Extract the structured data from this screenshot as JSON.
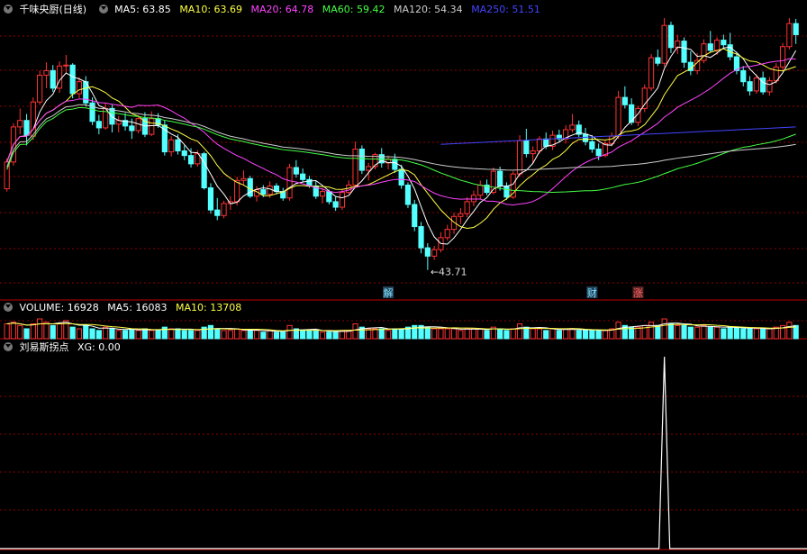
{
  "header": {
    "title": "千味央厨(日线)",
    "ma": [
      {
        "label": "MA5: 63.85",
        "color": "#ffffff"
      },
      {
        "label": "MA10: 63.69",
        "color": "#ffff44"
      },
      {
        "label": "MA20: 64.78",
        "color": "#ff44ff"
      },
      {
        "label": "MA60: 59.42",
        "color": "#44ff44"
      },
      {
        "label": "MA120: 54.34",
        "color": "#cccccc"
      },
      {
        "label": "MA250: 51.51",
        "color": "#4444ff"
      }
    ]
  },
  "volume_header": {
    "label": "VOLUME: 16928",
    "ma5": "MA5: 16083",
    "ma10": "MA10: 13708"
  },
  "indicator_header": {
    "label": "刘易斯拐点",
    "xg": "XG: 0.00"
  },
  "annotations": {
    "low_label": "←43.71",
    "markers": [
      {
        "text": "解",
        "color": "#7fe0ff",
        "bg": "#23435a"
      },
      {
        "text": "财",
        "color": "#7fe0ff",
        "bg": "#23435a"
      },
      {
        "text": "涨",
        "color": "#ff6666",
        "bg": "#5a2323"
      }
    ]
  },
  "colors": {
    "up": "#ff3232",
    "down": "#54ffff",
    "grid": "#8b0000",
    "ma5": "#ffffff",
    "ma10": "#ffff44",
    "ma20": "#ff44ff",
    "ma60": "#44ff44",
    "ma120": "#cccccc",
    "ma250": "#4444ff",
    "xg": "#ffffff"
  },
  "chart_data": {
    "type": "candlestick",
    "price_range": [
      42.5,
      71.0
    ],
    "candles": [
      [
        52.5,
        55.8,
        52.2,
        55.4
      ],
      [
        55.4,
        59.6,
        55.0,
        59.2
      ],
      [
        59.2,
        61.2,
        58.4,
        59.9
      ],
      [
        59.9,
        60.6,
        57.2,
        58.3
      ],
      [
        58.2,
        62.4,
        57.8,
        61.9
      ],
      [
        61.9,
        65.3,
        61.6,
        64.8
      ],
      [
        64.8,
        66.2,
        63.4,
        65.3
      ],
      [
        65.3,
        65.9,
        63.0,
        63.4
      ],
      [
        63.4,
        66.3,
        62.9,
        65.8
      ],
      [
        65.8,
        67.0,
        65.1,
        65.9
      ],
      [
        65.9,
        66.1,
        62.3,
        62.8
      ],
      [
        62.8,
        64.6,
        62.3,
        64.1
      ],
      [
        64.1,
        64.7,
        61.4,
        61.8
      ],
      [
        61.8,
        62.4,
        59.4,
        59.8
      ],
      [
        59.8,
        60.5,
        58.4,
        59.1
      ],
      [
        59.1,
        61.8,
        58.9,
        61.2
      ],
      [
        61.2,
        61.6,
        58.6,
        59.5
      ],
      [
        59.5,
        60.4,
        58.6,
        59.9
      ],
      [
        59.9,
        60.7,
        58.8,
        59.3
      ],
      [
        59.3,
        60.1,
        57.9,
        58.8
      ],
      [
        58.8,
        60.5,
        58.5,
        60.1
      ],
      [
        60.1,
        60.8,
        58.1,
        58.4
      ],
      [
        58.4,
        60.9,
        58.2,
        60.1
      ],
      [
        60.1,
        60.7,
        59.1,
        59.4
      ],
      [
        59.4,
        59.9,
        56.1,
        56.5
      ],
      [
        56.5,
        58.2,
        56.0,
        57.8
      ],
      [
        57.8,
        58.4,
        56.2,
        56.6
      ],
      [
        56.6,
        57.2,
        55.6,
        56.1
      ],
      [
        56.1,
        56.9,
        54.8,
        55.2
      ],
      [
        55.2,
        56.7,
        54.9,
        56.3
      ],
      [
        56.3,
        56.5,
        52.4,
        52.6
      ],
      [
        52.6,
        53.1,
        49.8,
        50.2
      ],
      [
        50.2,
        51.5,
        49.1,
        49.6
      ],
      [
        49.6,
        51.2,
        49.3,
        50.9
      ],
      [
        50.9,
        51.7,
        50.2,
        51.1
      ],
      [
        51.1,
        53.8,
        50.7,
        53.4
      ],
      [
        53.4,
        54.5,
        52.9,
        53.6
      ],
      [
        53.6,
        53.9,
        51.5,
        51.7
      ],
      [
        51.7,
        52.8,
        51.1,
        52.4
      ],
      [
        52.4,
        52.9,
        51.6,
        51.9
      ],
      [
        51.9,
        53.3,
        51.5,
        52.8
      ],
      [
        52.8,
        53.1,
        51.9,
        52.2
      ],
      [
        52.2,
        52.6,
        51.2,
        51.5
      ],
      [
        51.5,
        55.2,
        51.2,
        54.8
      ],
      [
        54.8,
        55.6,
        53.7,
        54.1
      ],
      [
        54.1,
        54.7,
        53.2,
        53.5
      ],
      [
        53.5,
        53.9,
        52.6,
        52.8
      ],
      [
        52.8,
        53.3,
        51.4,
        51.7
      ],
      [
        51.7,
        52.6,
        50.9,
        52.2
      ],
      [
        52.2,
        52.4,
        50.8,
        51.1
      ],
      [
        51.1,
        51.6,
        50.1,
        50.5
      ],
      [
        50.5,
        52.4,
        50.2,
        52.1
      ],
      [
        52.1,
        53.4,
        51.9,
        52.9
      ],
      [
        52.9,
        57.6,
        52.6,
        56.8
      ],
      [
        56.8,
        57.2,
        54.1,
        54.5
      ],
      [
        54.5,
        55.3,
        53.4,
        54.9
      ],
      [
        54.9,
        56.4,
        54.6,
        56.2
      ],
      [
        56.2,
        56.9,
        54.8,
        55.3
      ],
      [
        55.3,
        56.1,
        54.6,
        55.7
      ],
      [
        55.7,
        56.3,
        54.2,
        54.6
      ],
      [
        54.6,
        55.1,
        52.5,
        52.9
      ],
      [
        52.9,
        53.2,
        50.4,
        50.8
      ],
      [
        50.8,
        51.3,
        47.9,
        48.4
      ],
      [
        48.4,
        48.9,
        45.5,
        46.1
      ],
      [
        46.1,
        46.6,
        43.7,
        45.2
      ],
      [
        45.2,
        46.3,
        44.8,
        45.9
      ],
      [
        45.9,
        47.8,
        45.6,
        47.2
      ],
      [
        47.2,
        48.6,
        46.9,
        48.1
      ],
      [
        48.1,
        49.9,
        47.6,
        49.5
      ],
      [
        49.5,
        50.4,
        48.7,
        49.8
      ],
      [
        49.8,
        51.6,
        49.4,
        51.1
      ],
      [
        51.1,
        52.3,
        50.6,
        51.8
      ],
      [
        51.8,
        53.4,
        51.4,
        52.9
      ],
      [
        52.9,
        53.5,
        51.8,
        52.1
      ],
      [
        52.1,
        54.8,
        51.9,
        54.4
      ],
      [
        54.4,
        54.9,
        52.3,
        52.8
      ],
      [
        52.8,
        53.2,
        51.3,
        51.6
      ],
      [
        51.6,
        54.4,
        51.4,
        54.1
      ],
      [
        54.1,
        58.3,
        53.8,
        57.7
      ],
      [
        57.7,
        59.0,
        55.9,
        56.3
      ],
      [
        56.3,
        57.1,
        55.2,
        56.6
      ],
      [
        56.6,
        58.2,
        56.3,
        57.9
      ],
      [
        57.9,
        58.6,
        56.8,
        57.1
      ],
      [
        57.1,
        58.8,
        56.7,
        58.3
      ],
      [
        58.3,
        58.9,
        57.6,
        57.9
      ],
      [
        57.9,
        59.4,
        57.4,
        58.9
      ],
      [
        58.9,
        60.6,
        58.6,
        59.4
      ],
      [
        59.4,
        59.9,
        58.1,
        58.4
      ],
      [
        58.4,
        59.1,
        57.2,
        57.6
      ],
      [
        57.6,
        58.3,
        56.4,
        56.8
      ],
      [
        56.8,
        57.4,
        55.6,
        56.1
      ],
      [
        56.1,
        57.8,
        55.9,
        57.4
      ],
      [
        57.4,
        58.6,
        57.1,
        58.2
      ],
      [
        58.2,
        63.1,
        57.9,
        62.4
      ],
      [
        62.4,
        63.6,
        61.2,
        61.6
      ],
      [
        61.6,
        62.3,
        59.4,
        59.7
      ],
      [
        59.7,
        61.5,
        59.3,
        61.2
      ],
      [
        61.2,
        63.8,
        60.8,
        63.4
      ],
      [
        63.4,
        67.1,
        63.1,
        66.7
      ],
      [
        66.7,
        67.6,
        65.8,
        66.1
      ],
      [
        66.1,
        71.0,
        65.7,
        70.2
      ],
      [
        70.2,
        70.6,
        67.2,
        67.8
      ],
      [
        67.8,
        69.2,
        67.1,
        68.5
      ],
      [
        68.5,
        68.9,
        65.6,
        66.2
      ],
      [
        66.2,
        67.4,
        64.8,
        65.3
      ],
      [
        65.3,
        67.2,
        64.9,
        66.4
      ],
      [
        66.4,
        68.7,
        66.1,
        68.2
      ],
      [
        68.2,
        69.6,
        67.3,
        67.5
      ],
      [
        67.5,
        68.9,
        67.0,
        68.6
      ],
      [
        68.6,
        69.2,
        67.6,
        68.1
      ],
      [
        68.1,
        69.4,
        66.4,
        66.8
      ],
      [
        66.8,
        67.3,
        64.9,
        65.3
      ],
      [
        65.3,
        65.8,
        63.6,
        64.1
      ],
      [
        64.1,
        64.7,
        62.6,
        63.1
      ],
      [
        63.1,
        64.9,
        62.8,
        64.5
      ],
      [
        64.5,
        65.2,
        62.7,
        63.0
      ],
      [
        63.0,
        64.6,
        62.6,
        64.2
      ],
      [
        64.2,
        66.1,
        63.9,
        65.7
      ],
      [
        65.7,
        68.3,
        65.3,
        67.9
      ],
      [
        67.9,
        71.0,
        67.6,
        70.4
      ],
      [
        70.4,
        70.9,
        68.2,
        69.2
      ]
    ],
    "volume": [
      0.9,
      1.0,
      0.8,
      0.6,
      0.9,
      1.2,
      1.0,
      0.8,
      0.9,
      1.1,
      0.7,
      0.6,
      0.8,
      0.6,
      0.5,
      0.7,
      0.6,
      0.5,
      0.5,
      0.6,
      0.5,
      0.6,
      0.5,
      0.5,
      0.7,
      0.6,
      0.6,
      0.5,
      0.5,
      0.5,
      0.7,
      0.8,
      0.6,
      0.5,
      0.5,
      0.6,
      0.5,
      0.5,
      0.5,
      0.4,
      0.5,
      0.4,
      0.4,
      0.8,
      0.6,
      0.5,
      0.5,
      0.5,
      0.4,
      0.4,
      0.4,
      0.5,
      0.5,
      0.9,
      0.7,
      0.6,
      0.6,
      0.6,
      0.5,
      0.6,
      0.6,
      0.7,
      0.8,
      0.8,
      0.7,
      0.6,
      0.6,
      0.6,
      0.6,
      0.5,
      0.6,
      0.6,
      0.6,
      0.5,
      0.7,
      0.6,
      0.5,
      0.6,
      0.9,
      0.7,
      0.6,
      0.6,
      0.5,
      0.6,
      0.5,
      0.6,
      0.6,
      0.5,
      0.5,
      0.5,
      0.5,
      0.5,
      0.6,
      1.0,
      0.8,
      0.7,
      0.7,
      0.8,
      1.0,
      0.8,
      1.2,
      0.9,
      0.8,
      0.8,
      0.7,
      0.7,
      0.8,
      0.7,
      0.7,
      0.6,
      0.7,
      0.7,
      0.6,
      0.6,
      0.6,
      0.6,
      0.6,
      0.7,
      0.8,
      1.0,
      0.8
    ],
    "xg_signal_index": 100
  }
}
